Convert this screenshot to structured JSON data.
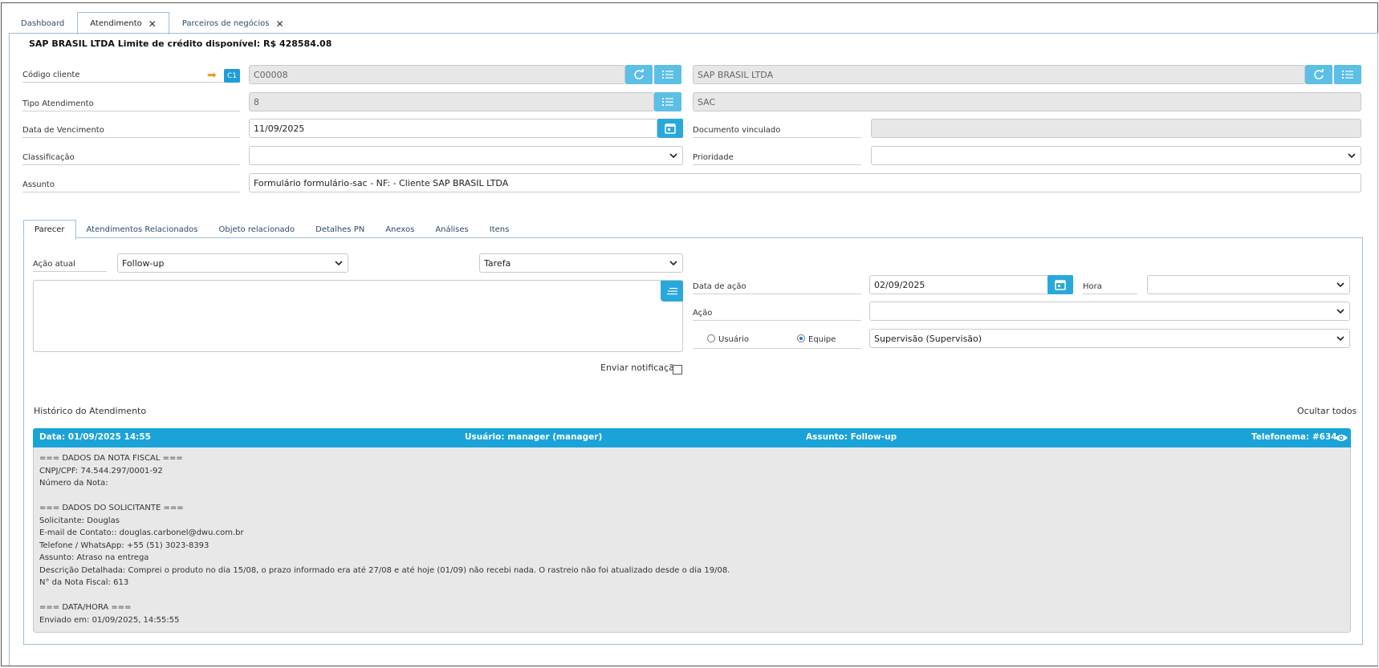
{
  "tabs": [
    {
      "label": "Dashboard"
    },
    {
      "label": "Atendimento"
    },
    {
      "label": "Parceiros de negócios"
    }
  ],
  "header": {
    "title": "SAP BRASIL LTDA Limite de crédito disponível: R$ 428584.08"
  },
  "form": {
    "codigo_cliente": {
      "label": "Código cliente",
      "badge": "C1",
      "value": "C00008",
      "name_value": "SAP BRASIL LTDA"
    },
    "tipo_atendimento": {
      "label": "Tipo Atendimento",
      "value": "8",
      "desc_value": "SAC"
    },
    "data_vencimento": {
      "label": "Data de Vencimento",
      "value": "11/09/2025"
    },
    "documento_vinculado": {
      "label": "Documento vinculado",
      "value": ""
    },
    "classificacao": {
      "label": "Classificação",
      "value": ""
    },
    "prioridade": {
      "label": "Prioridade",
      "value": ""
    },
    "assunto": {
      "label": "Assunto",
      "value": "Formulário formulário-sac - NF:  - Cliente SAP BRASIL LTDA"
    }
  },
  "subtabs": [
    {
      "label": "Parecer"
    },
    {
      "label": "Atendimentos Relacionados"
    },
    {
      "label": "Objeto relacionado"
    },
    {
      "label": "Detalhes PN"
    },
    {
      "label": "Anexos"
    },
    {
      "label": "Análises"
    },
    {
      "label": "Itens"
    }
  ],
  "parecer": {
    "acao_atual_label": "Ação atual",
    "acao_atual_value": "Follow-up",
    "tipo_value": "Tarefa",
    "data_acao_label": "Data de ação",
    "data_acao_value": "02/09/2025",
    "hora_label": "Hora",
    "hora_value": "",
    "acao_label": "Ação",
    "acao_value": "",
    "radio_usuario": "Usuário",
    "radio_equipe": "Equipe",
    "equipe_value": "Supervisão (Supervisão)",
    "enviar_notificacao": "Enviar notificação"
  },
  "history": {
    "title": "Histórico do Atendimento",
    "hide_all": "Ocultar todos",
    "entry": {
      "data": "Data: 01/09/2025 14:55",
      "usuario": "Usuário: manager (manager)",
      "assunto": "Assunto: Follow-up",
      "telefonema": "Telefonema: #634",
      "lines": [
        "=== DADOS DA NOTA FISCAL ===",
        "CNPJ/CPF: 74.544.297/0001-92",
        "Número da Nota:",
        "",
        "=== DADOS DO SOLICITANTE ===",
        "Solicitante: Douglas",
        "E-mail de Contato:: douglas.carbonel@dwu.com.br",
        "Telefone / WhatsApp: +55 (51) 3023-8393",
        "Assunto: Atraso na entrega",
        "Descrição Detalhada: Comprei o produto no dia 15/08, o prazo informado era até 27/08 e até hoje (01/09) não recebi nada. O rastreio não foi atualizado desde o dia 19/08.",
        "N° da Nota Fiscal: 613",
        "",
        "=== DATA/HORA ===",
        "Enviado em: 01/09/2025, 14:55:55"
      ]
    }
  },
  "colors": {
    "accent": "#29a8dc",
    "header_bar": "#1aa3d8",
    "arrow": "#f39c2d"
  }
}
